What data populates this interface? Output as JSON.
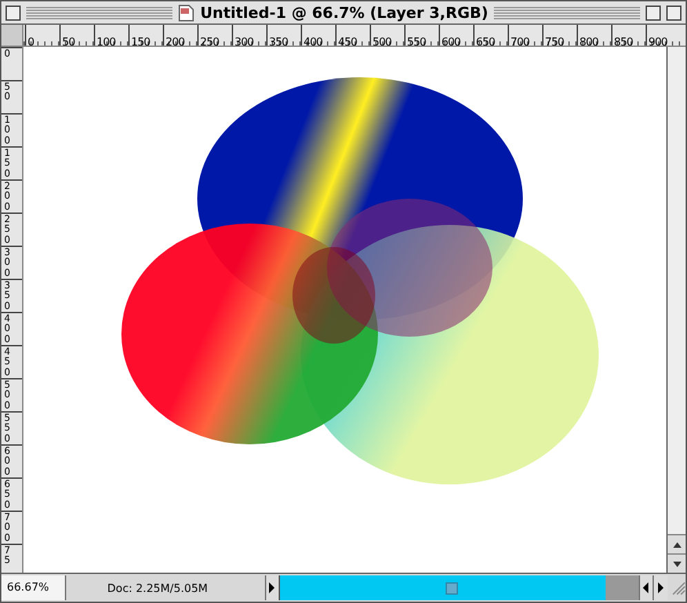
{
  "window": {
    "title": "Untitled-1 @ 66.7% (Layer 3,RGB)"
  },
  "rulers": {
    "horizontal": [
      "0",
      "50",
      "100",
      "150",
      "200",
      "250",
      "300",
      "350",
      "400",
      "450",
      "500",
      "550",
      "600",
      "650",
      "700",
      "750",
      "800",
      "850",
      "900"
    ],
    "vertical": [
      "0",
      "50",
      "100",
      "150",
      "200",
      "250",
      "300",
      "350",
      "400",
      "450",
      "500",
      "550",
      "600",
      "650",
      "700",
      "75"
    ]
  },
  "status_bar": {
    "zoom": "66.67%",
    "doc_info": "Doc: 2.25M/5.05M"
  }
}
